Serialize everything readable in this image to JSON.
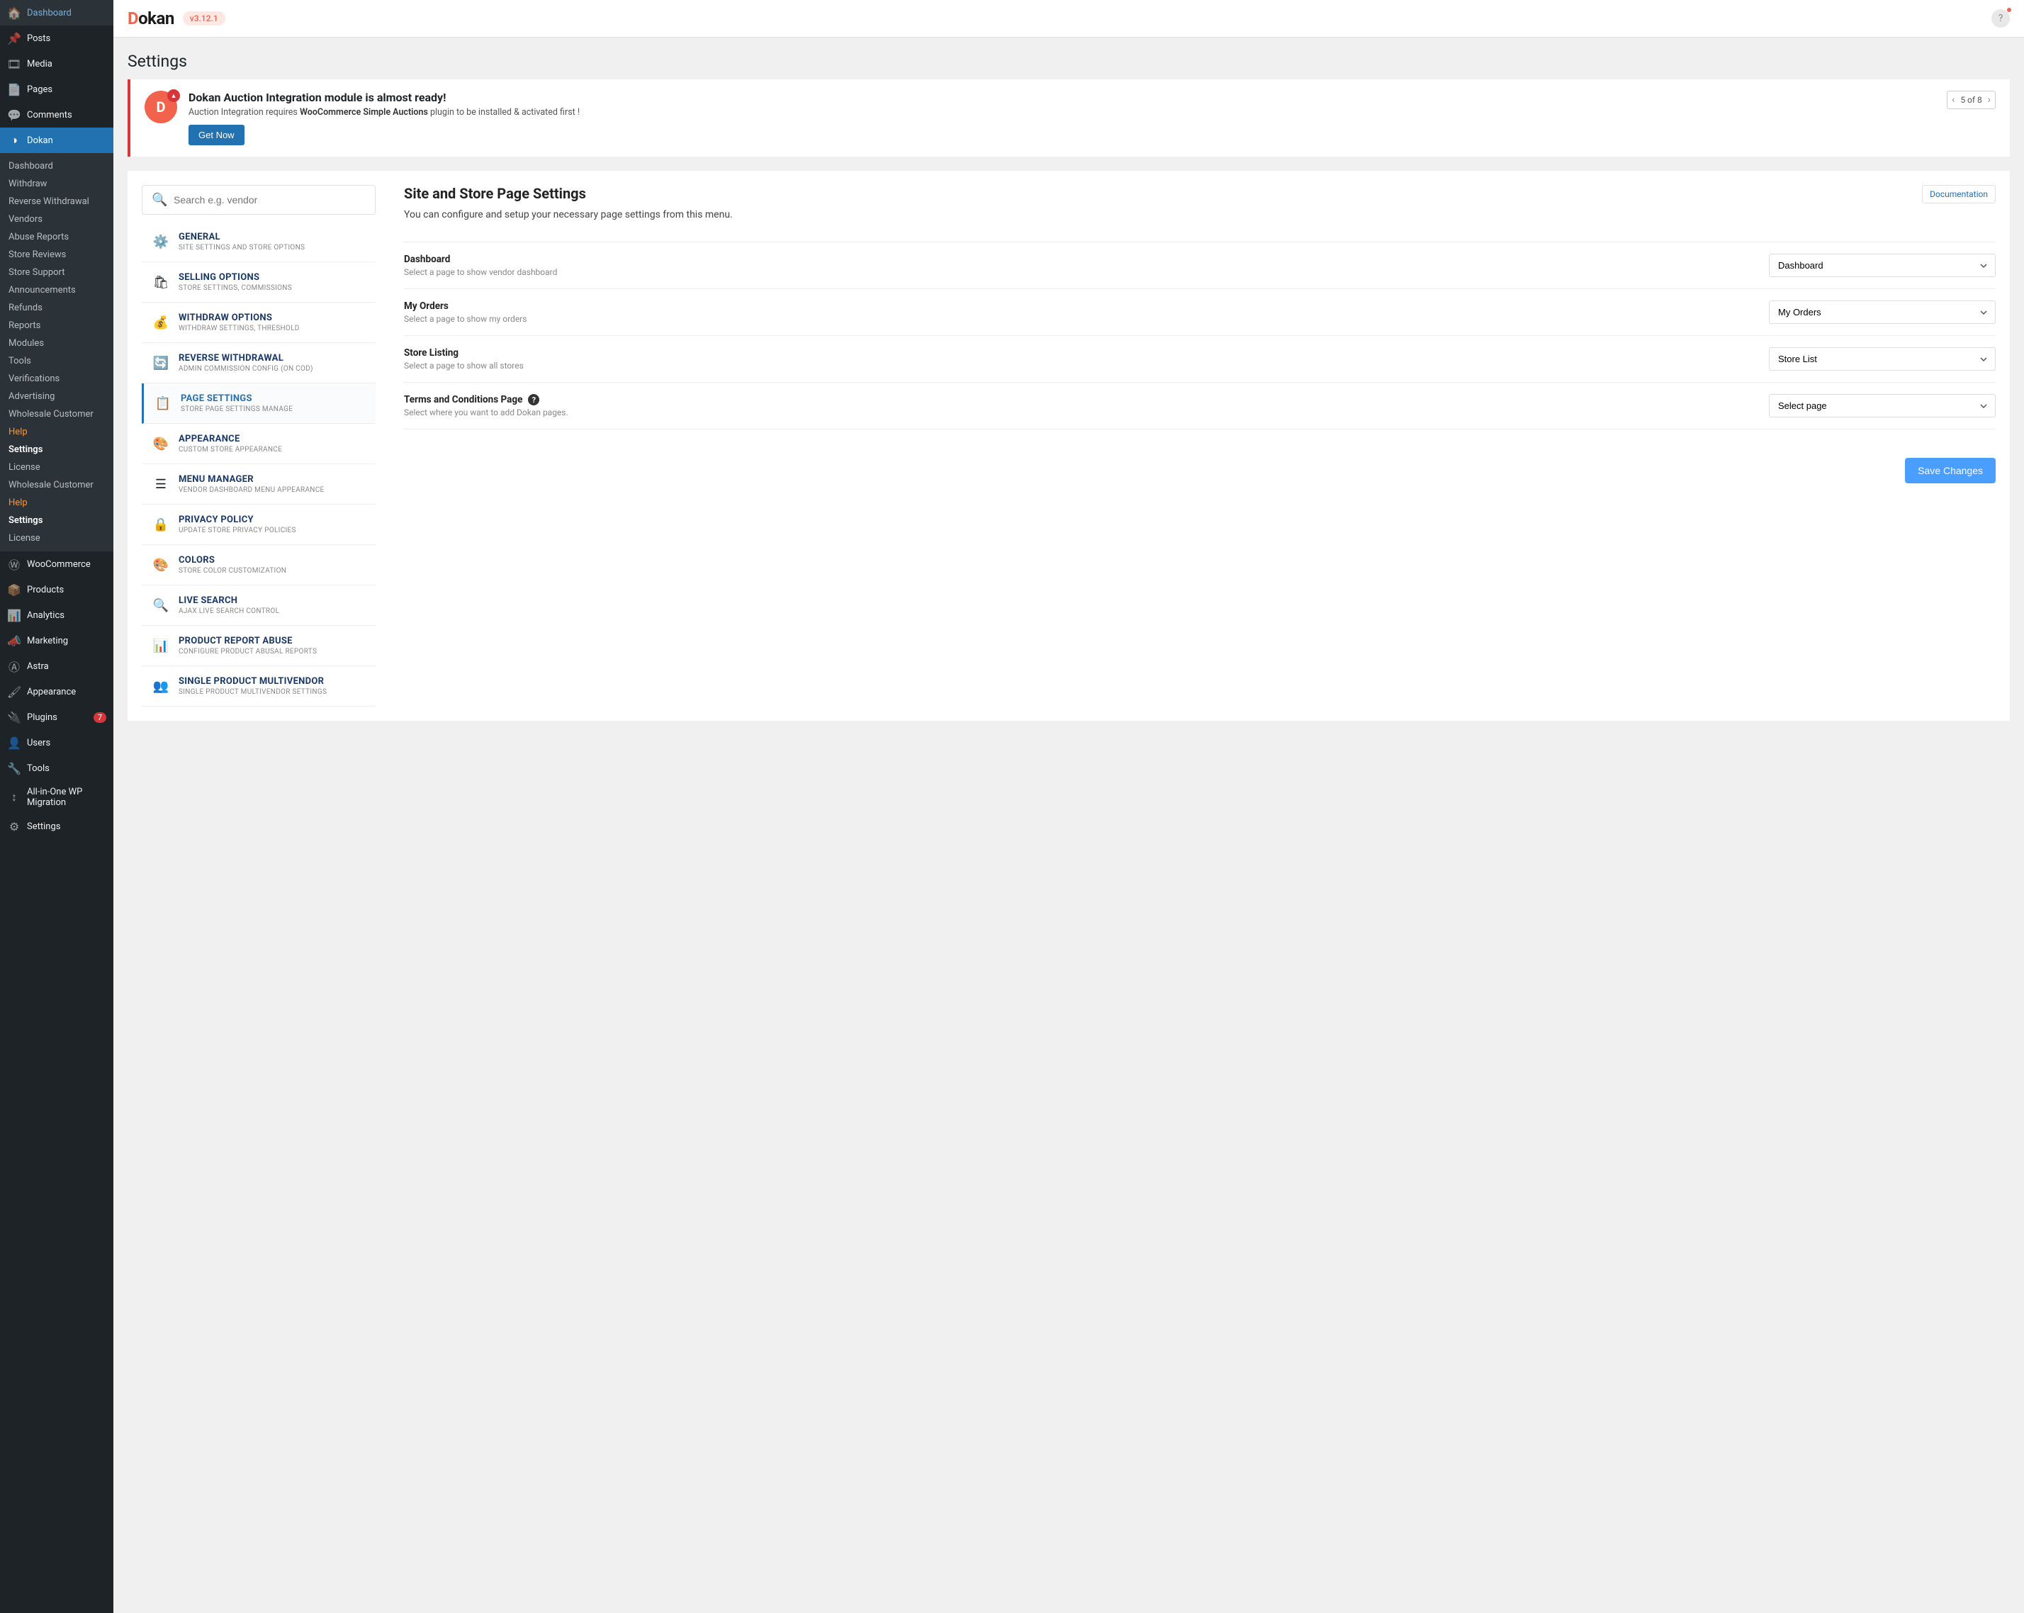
{
  "brand": {
    "name": "Dokan",
    "version": "v3.12.1"
  },
  "page_heading": "Settings",
  "sidebar": {
    "top": [
      {
        "label": "Dashboard",
        "icon": "🏠"
      },
      {
        "label": "Posts",
        "icon": "📌"
      },
      {
        "label": "Media",
        "icon": "🎞"
      },
      {
        "label": "Pages",
        "icon": "📄"
      },
      {
        "label": "Comments",
        "icon": "💬"
      },
      {
        "label": "Dokan",
        "icon": "◑",
        "active": true
      }
    ],
    "submenu": [
      {
        "label": "Dashboard"
      },
      {
        "label": "Withdraw"
      },
      {
        "label": "Reverse Withdrawal"
      },
      {
        "label": "Vendors"
      },
      {
        "label": "Abuse Reports"
      },
      {
        "label": "Store Reviews"
      },
      {
        "label": "Store Support"
      },
      {
        "label": "Announcements"
      },
      {
        "label": "Refunds"
      },
      {
        "label": "Reports"
      },
      {
        "label": "Modules"
      },
      {
        "label": "Tools"
      },
      {
        "label": "Verifications"
      },
      {
        "label": "Advertising"
      },
      {
        "label": "Wholesale Customer"
      },
      {
        "label": "Help",
        "highlight": true
      },
      {
        "label": "Settings",
        "current": true
      },
      {
        "label": "License"
      },
      {
        "label": "Wholesale Customer"
      },
      {
        "label": "Help",
        "highlight": true
      },
      {
        "label": "Settings",
        "current": true
      },
      {
        "label": "License"
      }
    ],
    "bottom": [
      {
        "label": "WooCommerce",
        "icon": "Ⓦ"
      },
      {
        "label": "Products",
        "icon": "📦"
      },
      {
        "label": "Analytics",
        "icon": "📊"
      },
      {
        "label": "Marketing",
        "icon": "📣"
      },
      {
        "label": "Astra",
        "icon": "Ⓐ"
      },
      {
        "label": "Appearance",
        "icon": "🖌"
      },
      {
        "label": "Plugins",
        "icon": "🔌",
        "badge": "7"
      },
      {
        "label": "Users",
        "icon": "👤"
      },
      {
        "label": "Tools",
        "icon": "🔧"
      },
      {
        "label": "All-in-One WP Migration",
        "icon": "↕"
      },
      {
        "label": "Settings",
        "icon": "⚙"
      }
    ]
  },
  "notice": {
    "title": "Dokan Auction Integration module is almost ready!",
    "text_before": "Auction Integration requires ",
    "text_bold": "WooCommerce Simple Auctions",
    "text_after": " plugin to be installed & activated first !",
    "button": "Get Now",
    "pager": "5 of 8"
  },
  "search": {
    "placeholder": "Search e.g. vendor"
  },
  "settings_nav": [
    {
      "title": "General",
      "desc": "Site settings and store options",
      "icon": "⚙️"
    },
    {
      "title": "Selling Options",
      "desc": "Store settings, commissions",
      "icon": "🛍"
    },
    {
      "title": "Withdraw Options",
      "desc": "Withdraw settings, threshold",
      "icon": "💰"
    },
    {
      "title": "Reverse Withdrawal",
      "desc": "Admin commission config (on COD)",
      "icon": "🔄"
    },
    {
      "title": "Page Settings",
      "desc": "Store page settings manage",
      "icon": "📋",
      "selected": true
    },
    {
      "title": "Appearance",
      "desc": "Custom store appearance",
      "icon": "🎨"
    },
    {
      "title": "Menu Manager",
      "desc": "Vendor dashboard menu appearance",
      "icon": "☰"
    },
    {
      "title": "Privacy Policy",
      "desc": "Update store privacy policies",
      "icon": "🔒"
    },
    {
      "title": "Colors",
      "desc": "Store color customization",
      "icon": "🎨"
    },
    {
      "title": "Live Search",
      "desc": "Ajax live search control",
      "icon": "🔍"
    },
    {
      "title": "Product Report Abuse",
      "desc": "Configure product abusal reports",
      "icon": "📊"
    },
    {
      "title": "Single Product Multivendor",
      "desc": "Single product multivendor settings",
      "icon": "👥"
    }
  ],
  "panel": {
    "title": "Site and Store Page Settings",
    "doc_link": "Documentation",
    "subtitle": "You can configure and setup your necessary page settings from this menu.",
    "fields": [
      {
        "label": "Dashboard",
        "desc": "Select a page to show vendor dashboard",
        "value": "Dashboard"
      },
      {
        "label": "My Orders",
        "desc": "Select a page to show my orders",
        "value": "My Orders"
      },
      {
        "label": "Store Listing",
        "desc": "Select a page to show all stores",
        "value": "Store List"
      },
      {
        "label": "Terms and Conditions Page",
        "desc": "Select where you want to add Dokan pages.",
        "value": "Select page",
        "help": true
      }
    ],
    "save": "Save Changes"
  }
}
